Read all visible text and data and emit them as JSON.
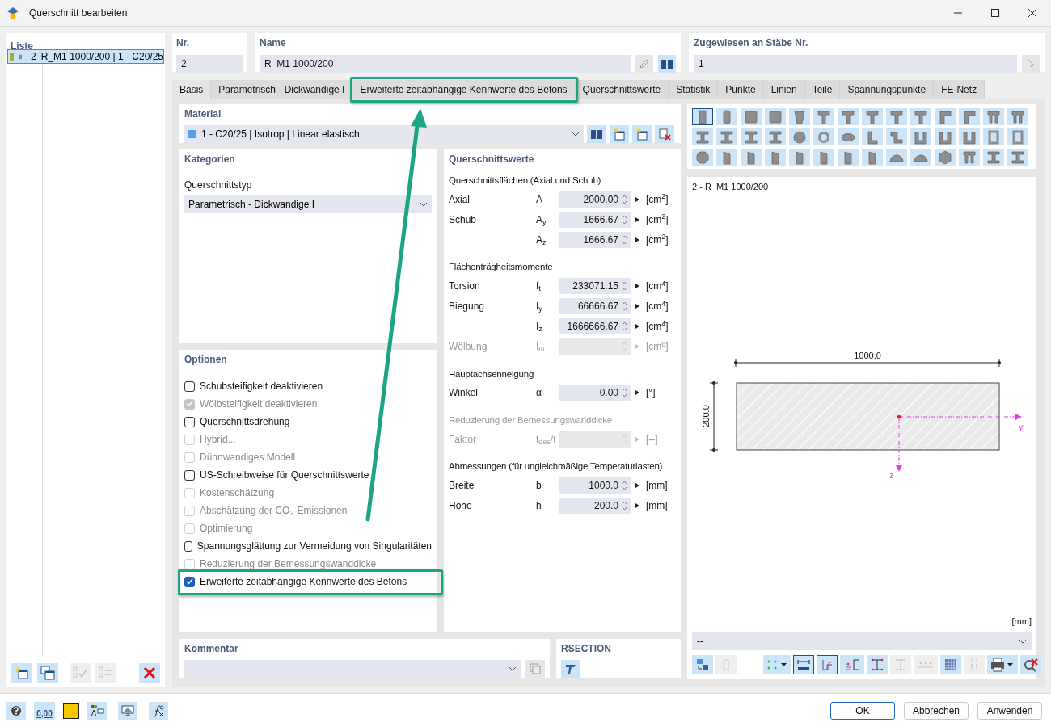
{
  "window": {
    "title": "Querschnitt bearbeiten"
  },
  "list": {
    "title": "Liste",
    "items": [
      {
        "number": "2",
        "label": "R_M1 1000/200 | 1 - C20/25",
        "selected": true,
        "color": "#a8a83c"
      }
    ]
  },
  "list_toolbar": [
    {
      "kind": "new",
      "disabled": false
    },
    {
      "kind": "copy",
      "disabled": false
    },
    {
      "kind": "check",
      "disabled": true
    },
    {
      "kind": "renumber",
      "disabled": true
    },
    {
      "kind": "delete",
      "disabled": false
    }
  ],
  "number": {
    "label": "Nr.",
    "value": "2"
  },
  "name": {
    "label": "Name",
    "value": "R_M1 1000/200"
  },
  "assigned": {
    "label": "Zugewiesen an Stäbe Nr.",
    "value": "1"
  },
  "tabs": [
    {
      "label": "Basis",
      "selected": true,
      "highlighted": false
    },
    {
      "label": "Parametrisch - Dickwandige I",
      "selected": false,
      "highlighted": false
    },
    {
      "label": "Erweiterte zeitabhängige Kennwerte des Betons",
      "selected": false,
      "highlighted": true
    },
    {
      "label": "Querschnittswerte",
      "selected": false,
      "highlighted": false
    },
    {
      "label": "Statistik",
      "selected": false,
      "highlighted": false
    },
    {
      "label": "Punkte",
      "selected": false,
      "highlighted": false
    },
    {
      "label": "Linien",
      "selected": false,
      "highlighted": false
    },
    {
      "label": "Teile",
      "selected": false,
      "highlighted": false
    },
    {
      "label": "Spannungspunkte",
      "selected": false,
      "highlighted": false
    },
    {
      "label": "FE-Netz",
      "selected": false,
      "highlighted": false
    }
  ],
  "material": {
    "label": "Material",
    "value": "1 - C20/25 | Isotrop | Linear elastisch",
    "color": "#4da3f0"
  },
  "categories": {
    "title": "Kategorien",
    "type_label": "Querschnittstyp",
    "type_value": "Parametrisch - Dickwandige I"
  },
  "options": {
    "title": "Optionen",
    "items": [
      {
        "label": "Schubsteifigkeit deaktivieren",
        "checked": false,
        "disabled": false,
        "highlighted": false
      },
      {
        "label": "Wölbsteifigkeit deaktivieren",
        "checked": true,
        "disabled": true,
        "highlighted": false
      },
      {
        "label": "Querschnittsdrehung",
        "checked": false,
        "disabled": false,
        "highlighted": false
      },
      {
        "label": "Hybrid...",
        "checked": false,
        "disabled": true,
        "highlighted": false
      },
      {
        "label": "Dünnwandiges Modell",
        "checked": false,
        "disabled": true,
        "highlighted": false
      },
      {
        "label": "US-Schreibweise für Querschnittswerte",
        "checked": false,
        "disabled": false,
        "highlighted": false
      },
      {
        "label": "Kostenschätzung",
        "checked": false,
        "disabled": true,
        "highlighted": false
      },
      {
        "label": "Abschätzung der CO$_{2}$-Emissionen",
        "checked": false,
        "disabled": true,
        "highlighted": false
      },
      {
        "label": "Optimierung",
        "checked": false,
        "disabled": true,
        "highlighted": false
      },
      {
        "label": "Spannungsglättung zur Vermeidung von Singularitäten",
        "checked": false,
        "disabled": false,
        "highlighted": false
      },
      {
        "label": "Reduzierung der Bemessungswanddicke",
        "checked": false,
        "disabled": true,
        "highlighted": false
      },
      {
        "label": "Erweiterte zeitabhängige Kennwerte des Betons",
        "checked": true,
        "disabled": false,
        "highlighted": true
      }
    ]
  },
  "values_panel": {
    "title": "Querschnittswerte",
    "groups": [
      {
        "title": "Querschnittsflächen (Axial und Schub)",
        "disabled": false,
        "rows": [
          {
            "label": "Axial",
            "symbol": "A",
            "value": "2000.00",
            "unit": "[cm$^{2}$]",
            "disabled": false
          },
          {
            "label": "Schub",
            "symbol": "A$_{y}$",
            "value": "1666.67",
            "unit": "[cm$^{2}$]",
            "disabled": false
          },
          {
            "symbol": "A$_{z}$",
            "value": "1666.67",
            "unit": "[cm$^{2}$]",
            "disabled": false
          }
        ]
      },
      {
        "title": "Flächenträgheitsmomente",
        "disabled": false,
        "rows": [
          {
            "label": "Torsion",
            "symbol": "I$_{t}$",
            "value": "233071.15",
            "unit": "[cm$^{4}$]",
            "disabled": false
          },
          {
            "label": "Biegung",
            "symbol": "I$_{y}$",
            "value": "66666.67",
            "unit": "[cm$^{4}$]",
            "disabled": false
          },
          {
            "symbol": "I$_{z}$",
            "value": "1666666.67",
            "unit": "[cm$^{4}$]",
            "disabled": false
          },
          {
            "label": "Wölbung",
            "symbol": "I$_{ω}$",
            "unit": "[cm$^{6}$]",
            "disabled": true
          }
        ]
      },
      {
        "title": "Hauptachsenneigung",
        "disabled": false,
        "rows": [
          {
            "label": "Winkel",
            "symbol": "α",
            "value": "0.00",
            "unit": "[°]",
            "disabled": false
          }
        ]
      },
      {
        "title": "Reduzierung der Bemessungswanddicke",
        "disabled": true,
        "rows": [
          {
            "label": "Faktor",
            "symbol": "t$_{des}$/t",
            "unit": "[--]",
            "disabled": true
          }
        ]
      },
      {
        "title": "Abmessungen (für ungleichmäßige Temperaturlasten)",
        "disabled": false,
        "rows": [
          {
            "label": "Breite",
            "symbol": "b",
            "value": "1000.0",
            "unit": "[mm]",
            "disabled": false
          },
          {
            "label": "Höhe",
            "symbol": "h",
            "value": "200.0",
            "unit": "[mm]",
            "disabled": false
          }
        ]
      }
    ]
  },
  "shapes": [
    {
      "kind": "rect",
      "selected": true
    },
    {
      "kind": "rounded",
      "selected": false
    },
    {
      "kind": "square",
      "selected": false
    },
    {
      "kind": "square",
      "selected": false
    },
    {
      "kind": "trapezoid",
      "selected": false
    },
    {
      "kind": "tee",
      "selected": false
    },
    {
      "kind": "tee",
      "selected": false
    },
    {
      "kind": "tee",
      "selected": false
    },
    {
      "kind": "tee",
      "selected": false
    },
    {
      "kind": "tee",
      "selected": false
    },
    {
      "kind": "gamma",
      "selected": false
    },
    {
      "kind": "gamma",
      "selected": false
    },
    {
      "kind": "pi",
      "selected": false
    },
    {
      "kind": "pi",
      "selected": false
    },
    {
      "kind": "ibeam",
      "selected": false
    },
    {
      "kind": "ibeam",
      "selected": false
    },
    {
      "kind": "ibeam",
      "selected": false
    },
    {
      "kind": "ibeam",
      "selected": false
    },
    {
      "kind": "circle",
      "selected": false
    },
    {
      "kind": "ring",
      "selected": false
    },
    {
      "kind": "ellipse",
      "selected": false
    },
    {
      "kind": "angle",
      "selected": false
    },
    {
      "kind": "zee",
      "selected": false
    },
    {
      "kind": "channel",
      "selected": false
    },
    {
      "kind": "channel",
      "selected": false
    },
    {
      "kind": "channel",
      "selected": false
    },
    {
      "kind": "box",
      "selected": false
    },
    {
      "kind": "box",
      "selected": false
    },
    {
      "kind": "octagon",
      "selected": false
    },
    {
      "kind": "polygon",
      "selected": false
    },
    {
      "kind": "polygon",
      "selected": false
    },
    {
      "kind": "polygon",
      "selected": false
    },
    {
      "kind": "polygon",
      "selected": false
    },
    {
      "kind": "polygon",
      "selected": false
    },
    {
      "kind": "polygon",
      "selected": false
    },
    {
      "kind": "polygon",
      "selected": false
    },
    {
      "kind": "semicircle",
      "selected": false
    },
    {
      "kind": "semicircle",
      "selected": false
    },
    {
      "kind": "hexagon",
      "selected": false
    },
    {
      "kind": "pi",
      "selected": false
    },
    {
      "kind": "ibeam",
      "selected": false
    },
    {
      "kind": "ibeam",
      "selected": false
    }
  ],
  "preview": {
    "title": "2 - R_M1 1000/200",
    "width_dimension": "1000.0",
    "height_dimension": "200.0",
    "y_axis": "y",
    "z_axis": "z",
    "unit": "[mm]",
    "dropdown_value": "--"
  },
  "preview_toolbar": [
    {
      "kind": "rotate",
      "disabled": false
    },
    {
      "kind": "outline",
      "disabled": true
    },
    {
      "kind": "points",
      "disabled": false,
      "selected": false
    },
    {
      "kind": "dimension",
      "disabled": false,
      "selected": true
    },
    {
      "kind": "axes",
      "disabled": false,
      "selected": true
    },
    {
      "kind": "shear-center",
      "disabled": false,
      "selected": false
    },
    {
      "kind": "ibeam-points",
      "disabled": false,
      "selected": false
    },
    {
      "kind": "ibeam-plain",
      "disabled": true,
      "selected": false
    },
    {
      "kind": "numbering",
      "disabled": true,
      "selected": false
    },
    {
      "kind": "grid",
      "disabled": false,
      "selected": false
    },
    {
      "kind": "stress-points",
      "disabled": true,
      "selected": false
    },
    {
      "kind": "print",
      "disabled": false,
      "selected": false
    },
    {
      "kind": "zoom-reset",
      "disabled": false,
      "selected": false
    }
  ],
  "comment": {
    "label": "Kommentar"
  },
  "rsection": {
    "label": "RSECTION"
  },
  "footer_tools": [
    {
      "kind": "help"
    },
    {
      "kind": "decimals",
      "text": "0,00"
    },
    {
      "kind": "color",
      "color": "#f7c600"
    },
    {
      "kind": "fonts"
    },
    {
      "kind": "view"
    },
    {
      "kind": "formula"
    }
  ],
  "buttons": [
    {
      "label": "OK",
      "default": true
    },
    {
      "label": "Abbrechen",
      "default": false
    },
    {
      "label": "Anwenden",
      "default": false
    }
  ]
}
